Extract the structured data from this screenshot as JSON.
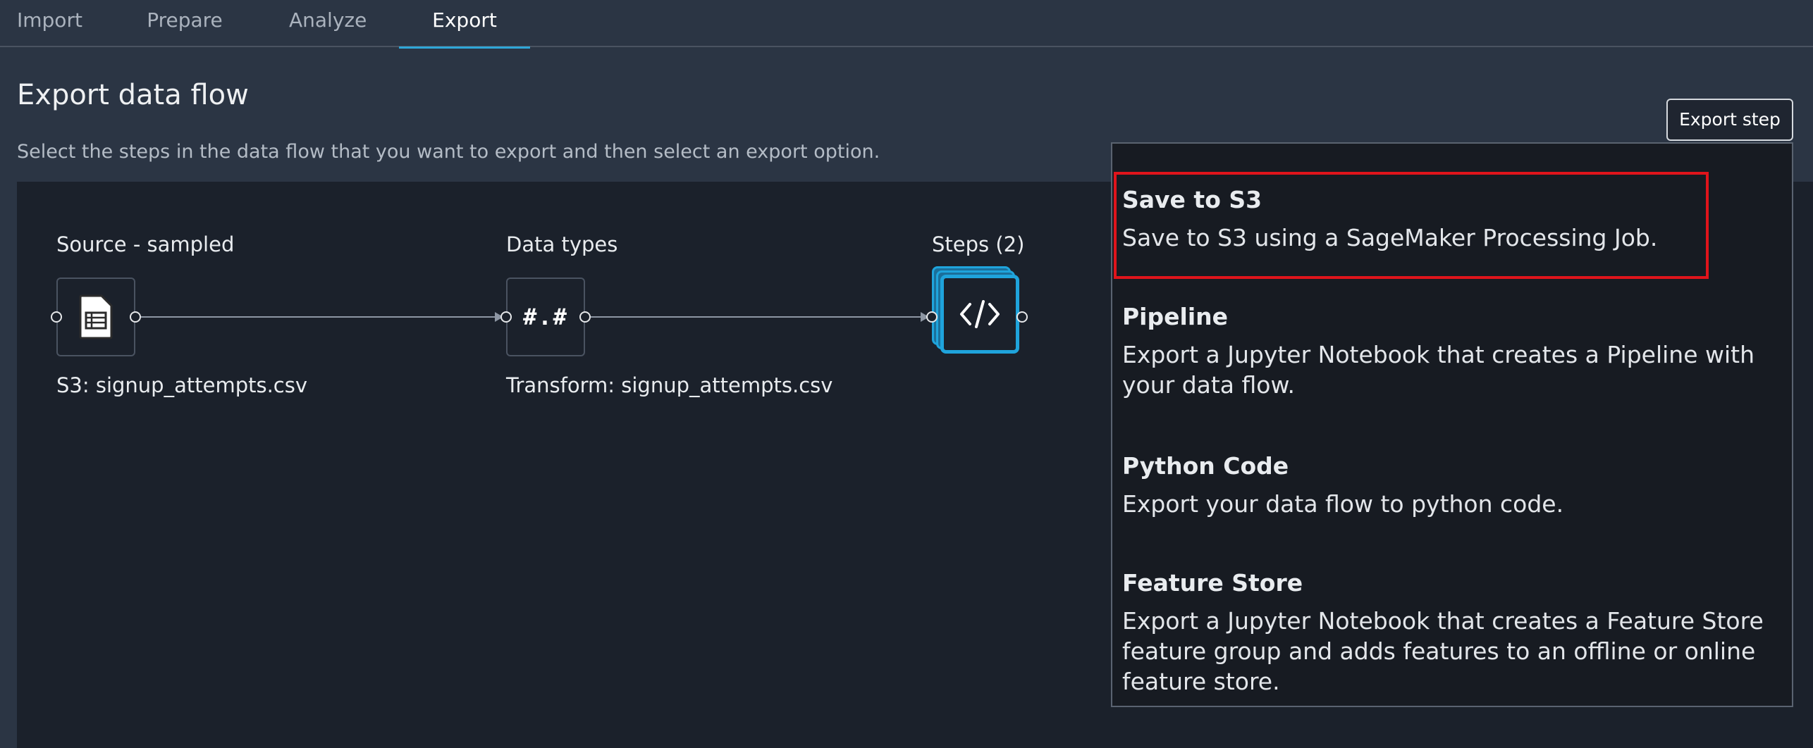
{
  "tabs": [
    {
      "label": "Import",
      "active": false
    },
    {
      "label": "Prepare",
      "active": false
    },
    {
      "label": "Analyze",
      "active": false
    },
    {
      "label": "Export",
      "active": true
    }
  ],
  "page": {
    "title": "Export data flow",
    "subtitle": "Select the steps in the data flow that you want to export and then select an export option."
  },
  "export_button": {
    "label": "Export step"
  },
  "flow": {
    "nodes": [
      {
        "label": "Source - sampled",
        "caption": "S3: signup_attempts.csv",
        "icon": "file-table-icon"
      },
      {
        "label": "Data types",
        "caption": "Transform: signup_attempts.csv",
        "icon": "hash-dot-hash-icon",
        "glyph": "#.#"
      },
      {
        "label": "Steps (2)",
        "caption": "",
        "icon": "code-icon"
      }
    ]
  },
  "export_menu": {
    "options": [
      {
        "title": "Save to S3",
        "description": "Save to S3 using a SageMaker Processing Job.",
        "highlighted": true
      },
      {
        "title": "Pipeline",
        "description": "Export a Jupyter Notebook that creates a Pipeline with your data flow."
      },
      {
        "title": "Python Code",
        "description": "Export your data flow to python code."
      },
      {
        "title": "Feature Store",
        "description": "Export a Jupyter Notebook that creates a Feature Store feature group and adds features to an offline or online feature store."
      }
    ]
  },
  "colors": {
    "accent": "#2ea6d8",
    "highlight": "#e0141b",
    "background": "#2b3544",
    "canvas": "#1b212b"
  }
}
